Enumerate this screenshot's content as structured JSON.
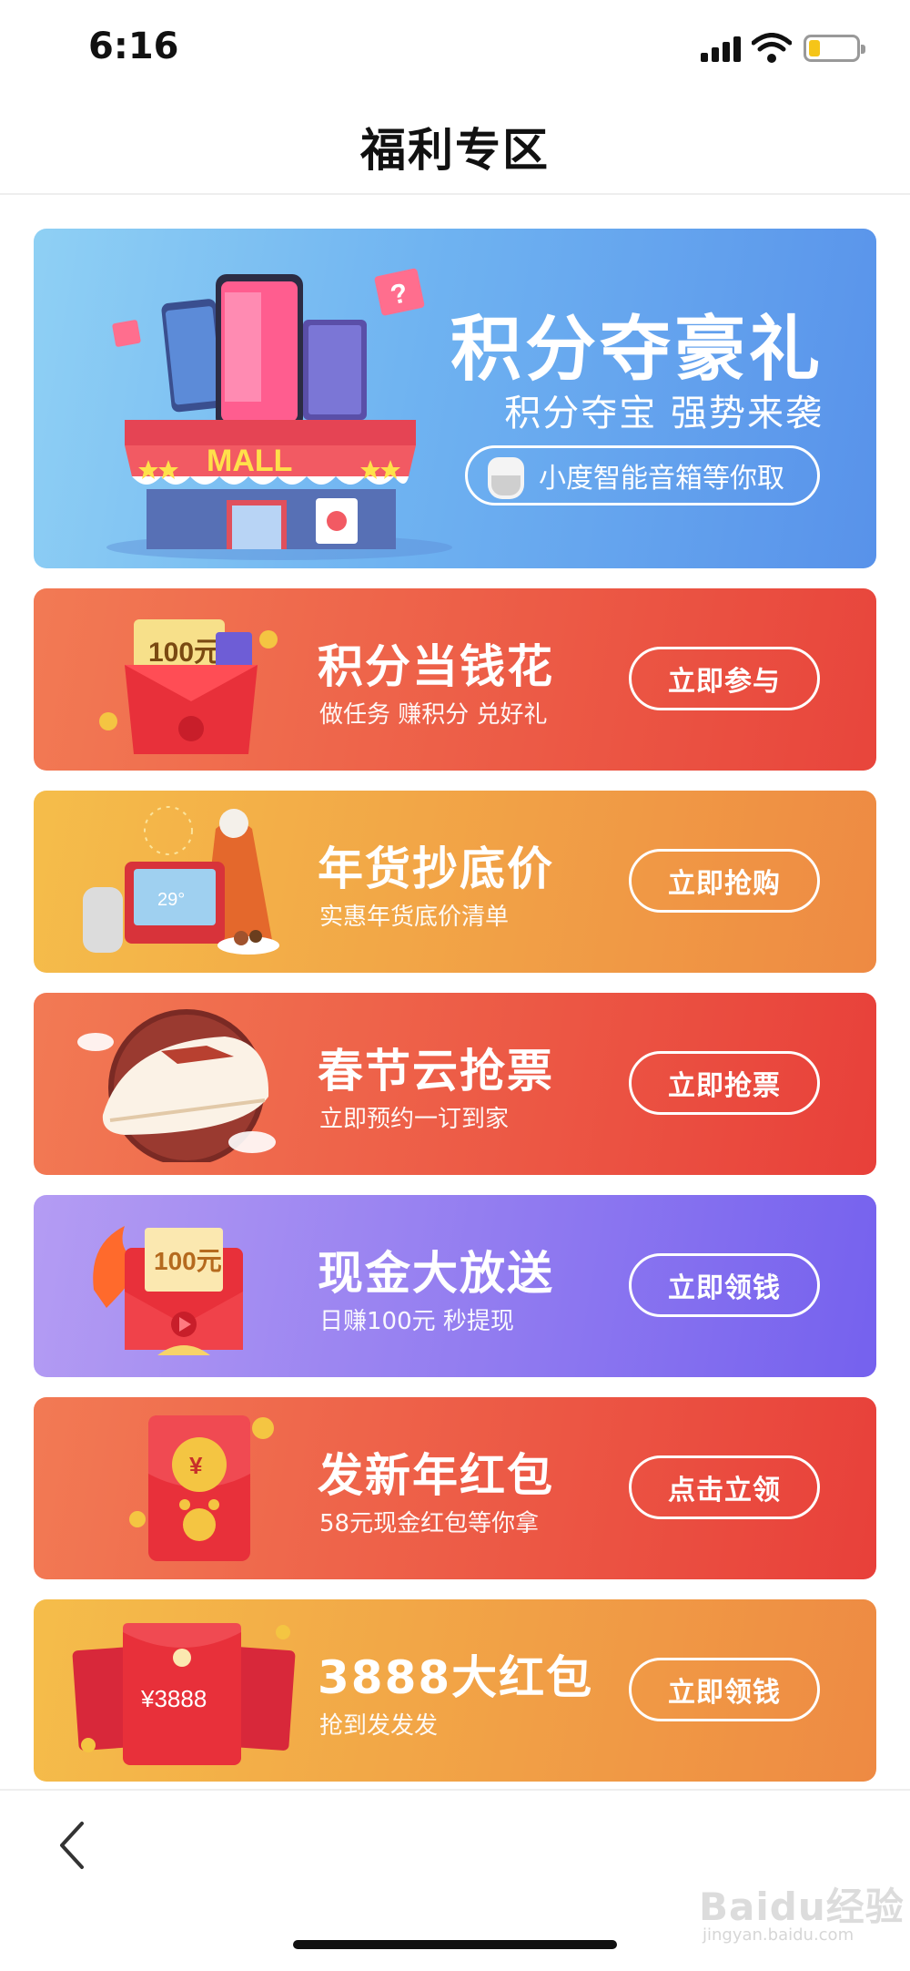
{
  "status_bar": {
    "time": "6:16"
  },
  "nav": {
    "title": "福利专区"
  },
  "banner": {
    "title": "积分夺豪礼",
    "subtitle": "积分夺宝 强势来袭",
    "pill_label": "小度智能音箱等你取",
    "art_sign": "MALL"
  },
  "cards": [
    {
      "title": "积分当钱花",
      "subtitle": "做任务 赚积分 兑好礼",
      "button": "立即参与",
      "colors": [
        "#f27a54",
        "#e8453c"
      ],
      "art_label": "100元"
    },
    {
      "title": "年货抄底价",
      "subtitle": "实惠年货底价清单",
      "button": "立即抢购",
      "colors": [
        "#f5bd4a",
        "#ee8a43"
      ],
      "art_label": "29°"
    },
    {
      "title": "春节云抢票",
      "subtitle": "立即预约一订到家",
      "button": "立即抢票",
      "colors": [
        "#f27a54",
        "#e8403a"
      ],
      "art_label": ""
    },
    {
      "title": "现金大放送",
      "subtitle": "日赚100元 秒提现",
      "button": "立即领钱",
      "colors": [
        "#b49cf3",
        "#7561ee"
      ],
      "art_label": "100元"
    },
    {
      "title": "发新年红包",
      "subtitle": "58元现金红包等你拿",
      "button": "点击立领",
      "colors": [
        "#f27a54",
        "#e8403a"
      ],
      "art_label": "¥"
    },
    {
      "title": "3888大红包",
      "subtitle": "抢到发发发",
      "button": "立即领钱",
      "colors": [
        "#f5bd4a",
        "#ee8a43"
      ],
      "art_label": "¥3888"
    }
  ],
  "watermark": {
    "brand": "Baidu经验",
    "url": "jingyan.baidu.com"
  }
}
